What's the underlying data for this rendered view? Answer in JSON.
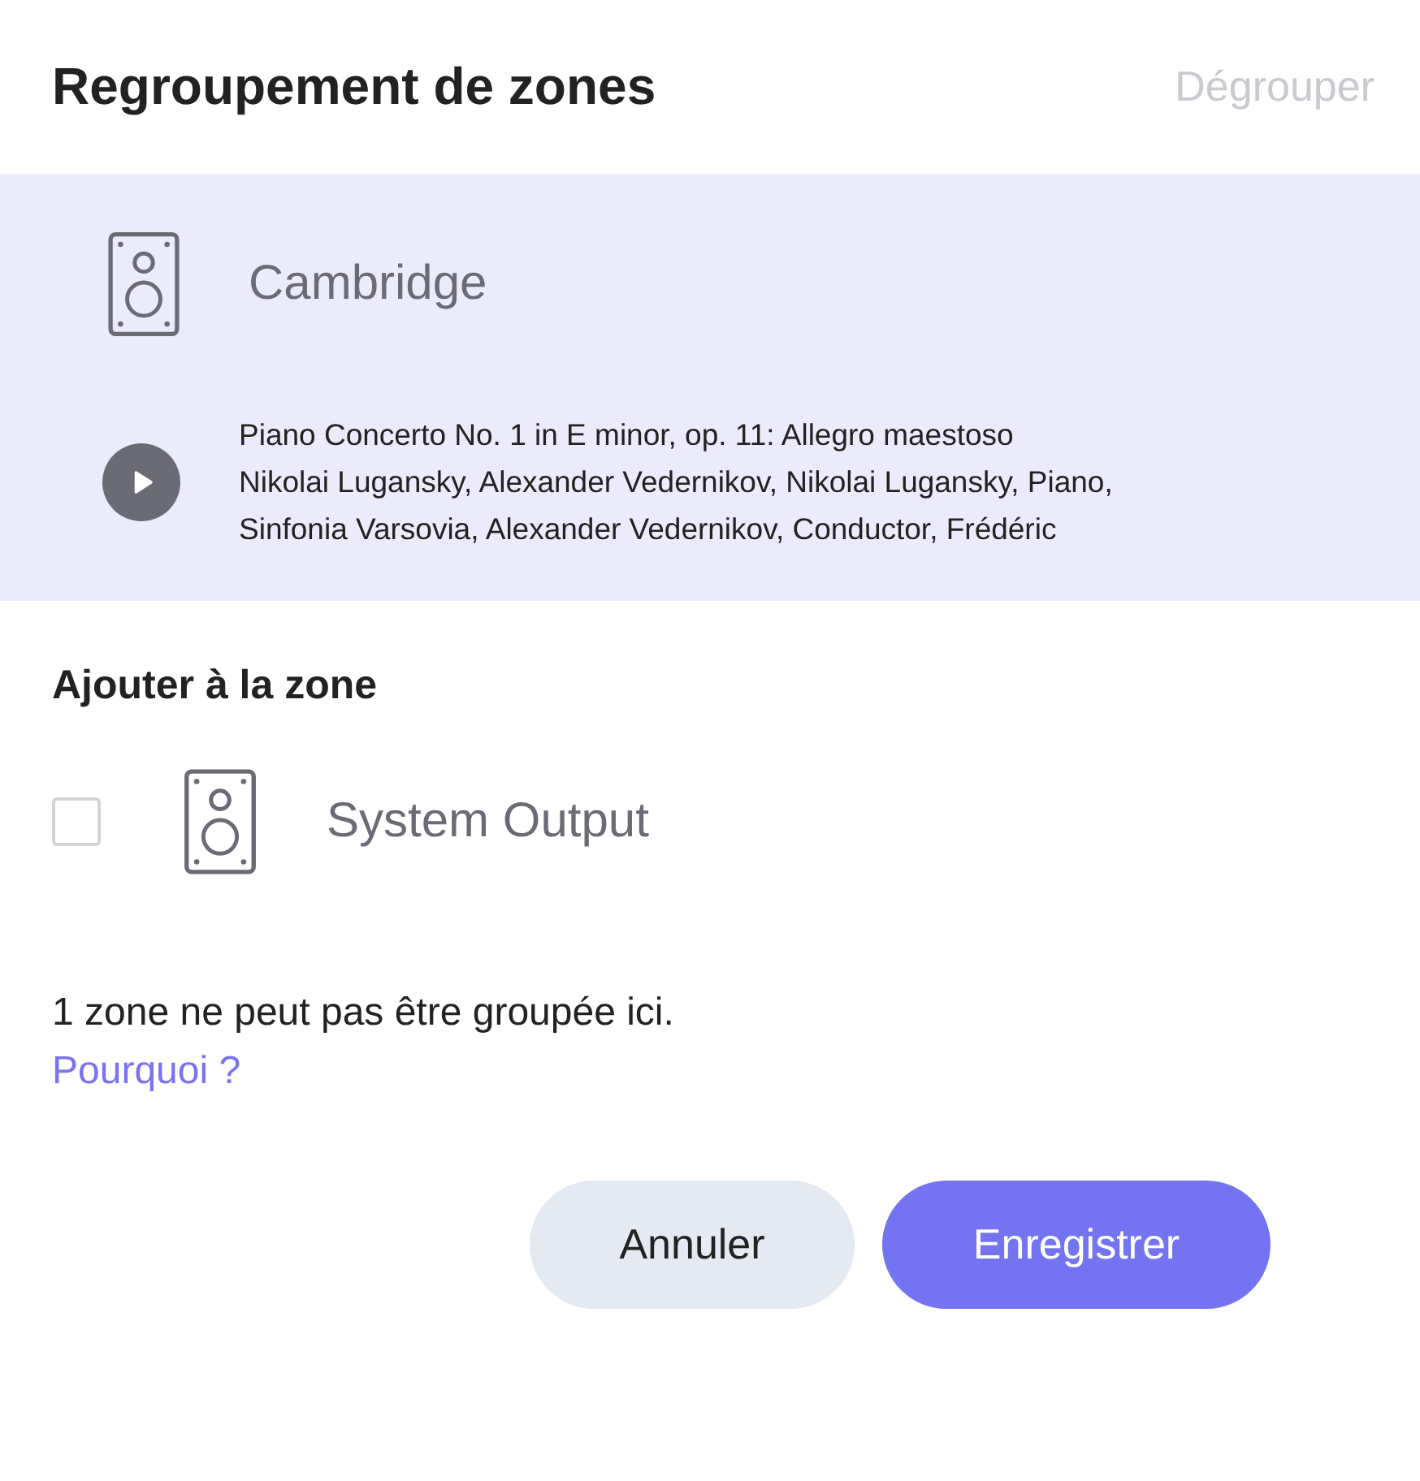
{
  "dialog": {
    "title": "Regroupement de zones",
    "ungroup_action": {
      "label": "Dégrouper",
      "disabled": true
    }
  },
  "current_zone": {
    "name": "Cambridge",
    "track": {
      "playing": false,
      "title": "Piano Concerto No. 1 in E minor, op. 11: Allegro maestoso",
      "artists": "Nikolai Lugansky, Alexander Vedernikov, Nikolai Lugansky, Piano, Sinfonia Varsovia, Alexander Vedernikov, Conductor, Frédéric"
    }
  },
  "add_section": {
    "heading": "Ajouter à la zone",
    "zones": [
      {
        "name": "System Output",
        "checked": false
      }
    ]
  },
  "notice": {
    "text": "1 zone ne peut pas être groupée ici.",
    "link": "Pourquoi ?"
  },
  "buttons": [
    {
      "label": "Annuler",
      "kind": "secondary"
    },
    {
      "label": "Enregistrer",
      "kind": "primary"
    }
  ]
}
